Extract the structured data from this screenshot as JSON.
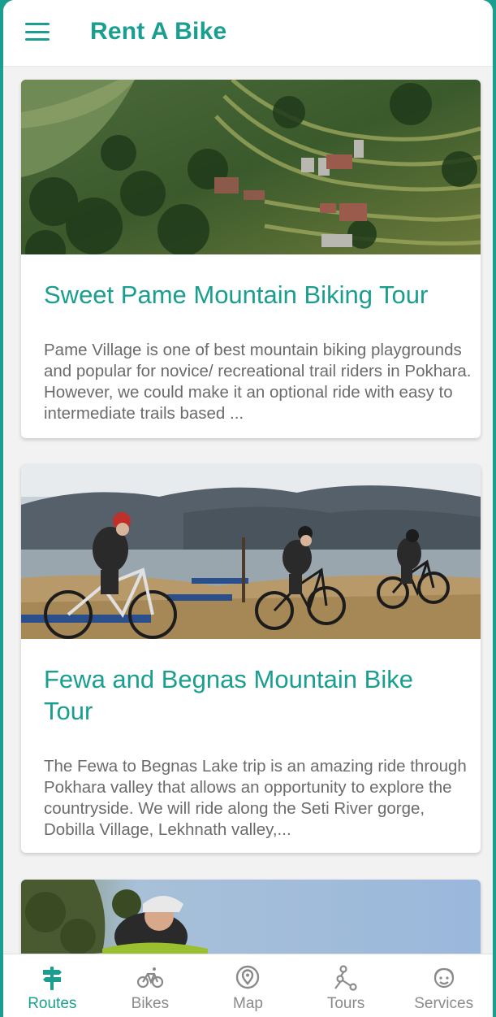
{
  "app": {
    "title": "Rent A Bike"
  },
  "colors": {
    "accent": "#1a9e8f",
    "text_muted": "#6b6b6b",
    "nav_inactive": "#8a8a8a"
  },
  "tours": [
    {
      "title": "Sweet Pame Mountain Biking Tour",
      "description": "Pame Village is one of best mountain biking playgrounds and popular for novice/ recreational trail riders in Pokhara. However, we could make it an optional ride with easy to intermediate trails based ..."
    },
    {
      "title": "Fewa and Begnas Mountain Bike Tour",
      "description": "The Fewa to Begnas Lake trip is an amazing ride through Pokhara valley that allows an opportunity to explore the countryside. We will ride along the Seti River gorge, Dobilla Village, Lekhnath valley,..."
    }
  ],
  "bottom_nav": [
    {
      "label": "Routes",
      "icon": "signpost-icon",
      "active": true
    },
    {
      "label": "Bikes",
      "icon": "bicycle-icon",
      "active": false
    },
    {
      "label": "Map",
      "icon": "map-pin-icon",
      "active": false
    },
    {
      "label": "Tours",
      "icon": "route-icon",
      "active": false
    },
    {
      "label": "Services",
      "icon": "support-icon",
      "active": false
    }
  ]
}
